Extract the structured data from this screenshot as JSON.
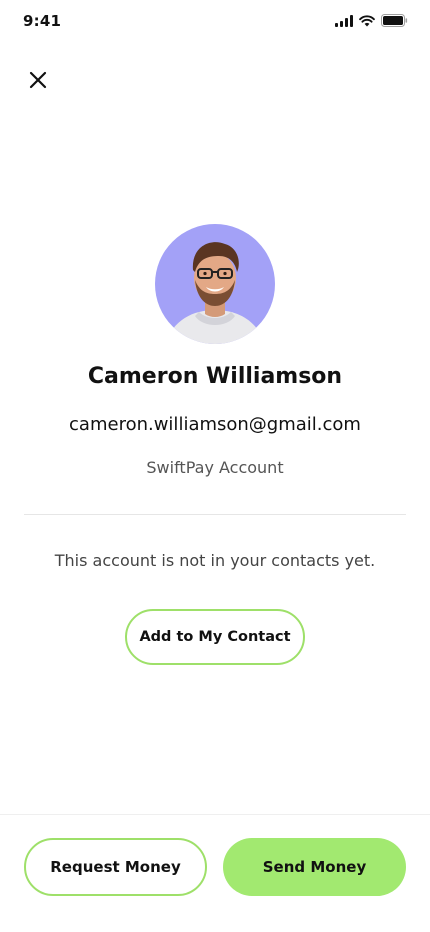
{
  "status_bar": {
    "time": "9:41",
    "icons": [
      "cellular-signal-icon",
      "wifi-icon",
      "battery-icon"
    ]
  },
  "header": {
    "close_icon": "close-icon"
  },
  "profile": {
    "name": "Cameron Williamson",
    "email": "cameron.williamson@gmail.com",
    "account_type": "SwiftPay Account",
    "avatar_background": "#A3A1F7"
  },
  "contact": {
    "note": "This account is not in your contacts yet.",
    "add_label": "Add to My Contact"
  },
  "actions": {
    "request_label": "Request Money",
    "send_label": "Send Money"
  },
  "colors": {
    "accent": "#A2E970",
    "accent_border": "#9EE069",
    "text": "#111111",
    "muted": "#555555"
  }
}
